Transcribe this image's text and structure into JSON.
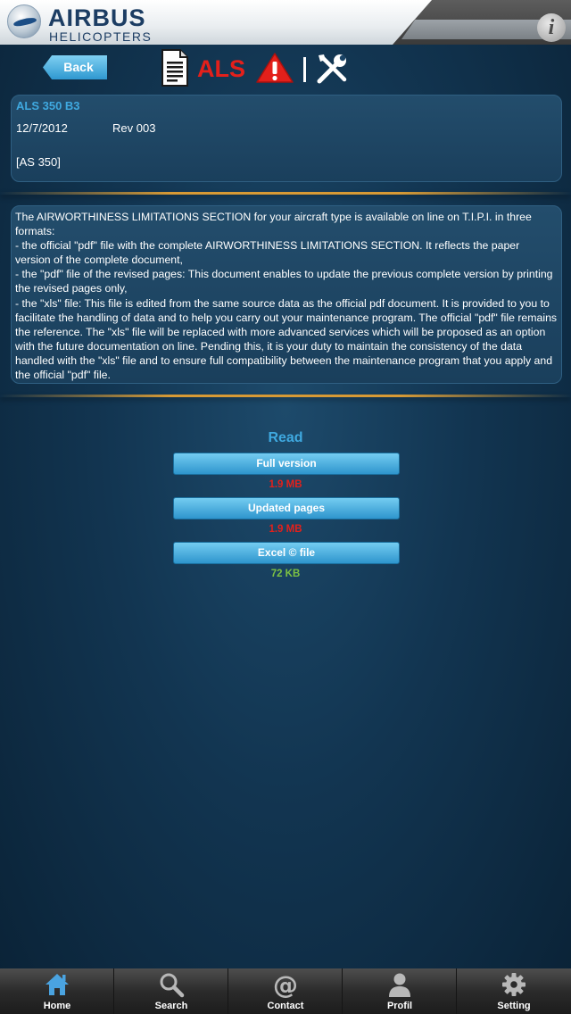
{
  "header": {
    "logo_main": "AIRBUS",
    "logo_sub": "HELICOPTERS",
    "info_glyph": "i"
  },
  "toolbar": {
    "back_label": "Back",
    "als_label": "ALS",
    "icons": [
      "document-icon",
      "warning-icon",
      "tools-icon"
    ]
  },
  "card": {
    "title": "ALS 350 B3",
    "date": "12/7/2012",
    "revision": "Rev 003",
    "aircraft": "[AS 350]"
  },
  "description": "The AIRWORTHINESS LIMITATIONS SECTION for your aircraft type is available on line on T.I.P.I. in three formats:\n- the official \"pdf\" file with the complete AIRWORTHINESS LIMITATIONS SECTION. It reflects the paper version of the complete document,\n- the \"pdf\" file of the revised pages: This document enables to update the previous complete version by printing the revised pages only,\n- the \"xls\" file: This file is edited from the same source data as the official pdf document. It is provided to you to facilitate the handling of data and to help you carry out your maintenance program. The official \"pdf\" file remains the reference. The \"xls\" file will be replaced with more advanced services which will be proposed as an option with the future documentation on line. Pending this, it is your duty to maintain the consistency of the data handled with the \"xls\" file and to ensure full compatibility between the maintenance program that you apply and the official \"pdf\" file.",
  "read": {
    "title": "Read",
    "items": [
      {
        "label": "Full version",
        "size": "1.9 MB",
        "size_color": "#e3201b"
      },
      {
        "label": "Updated pages",
        "size": "1.9 MB",
        "size_color": "#e3201b"
      },
      {
        "label": "Excel © file",
        "size": "72 KB",
        "size_color": "#7cc143"
      }
    ]
  },
  "tabbar": {
    "items": [
      {
        "label": "Home",
        "icon": "home-icon"
      },
      {
        "label": "Search",
        "icon": "search-icon"
      },
      {
        "label": "Contact",
        "icon": "at-icon"
      },
      {
        "label": "Profil",
        "icon": "person-icon"
      },
      {
        "label": "Setting",
        "icon": "gear-icon"
      }
    ]
  }
}
